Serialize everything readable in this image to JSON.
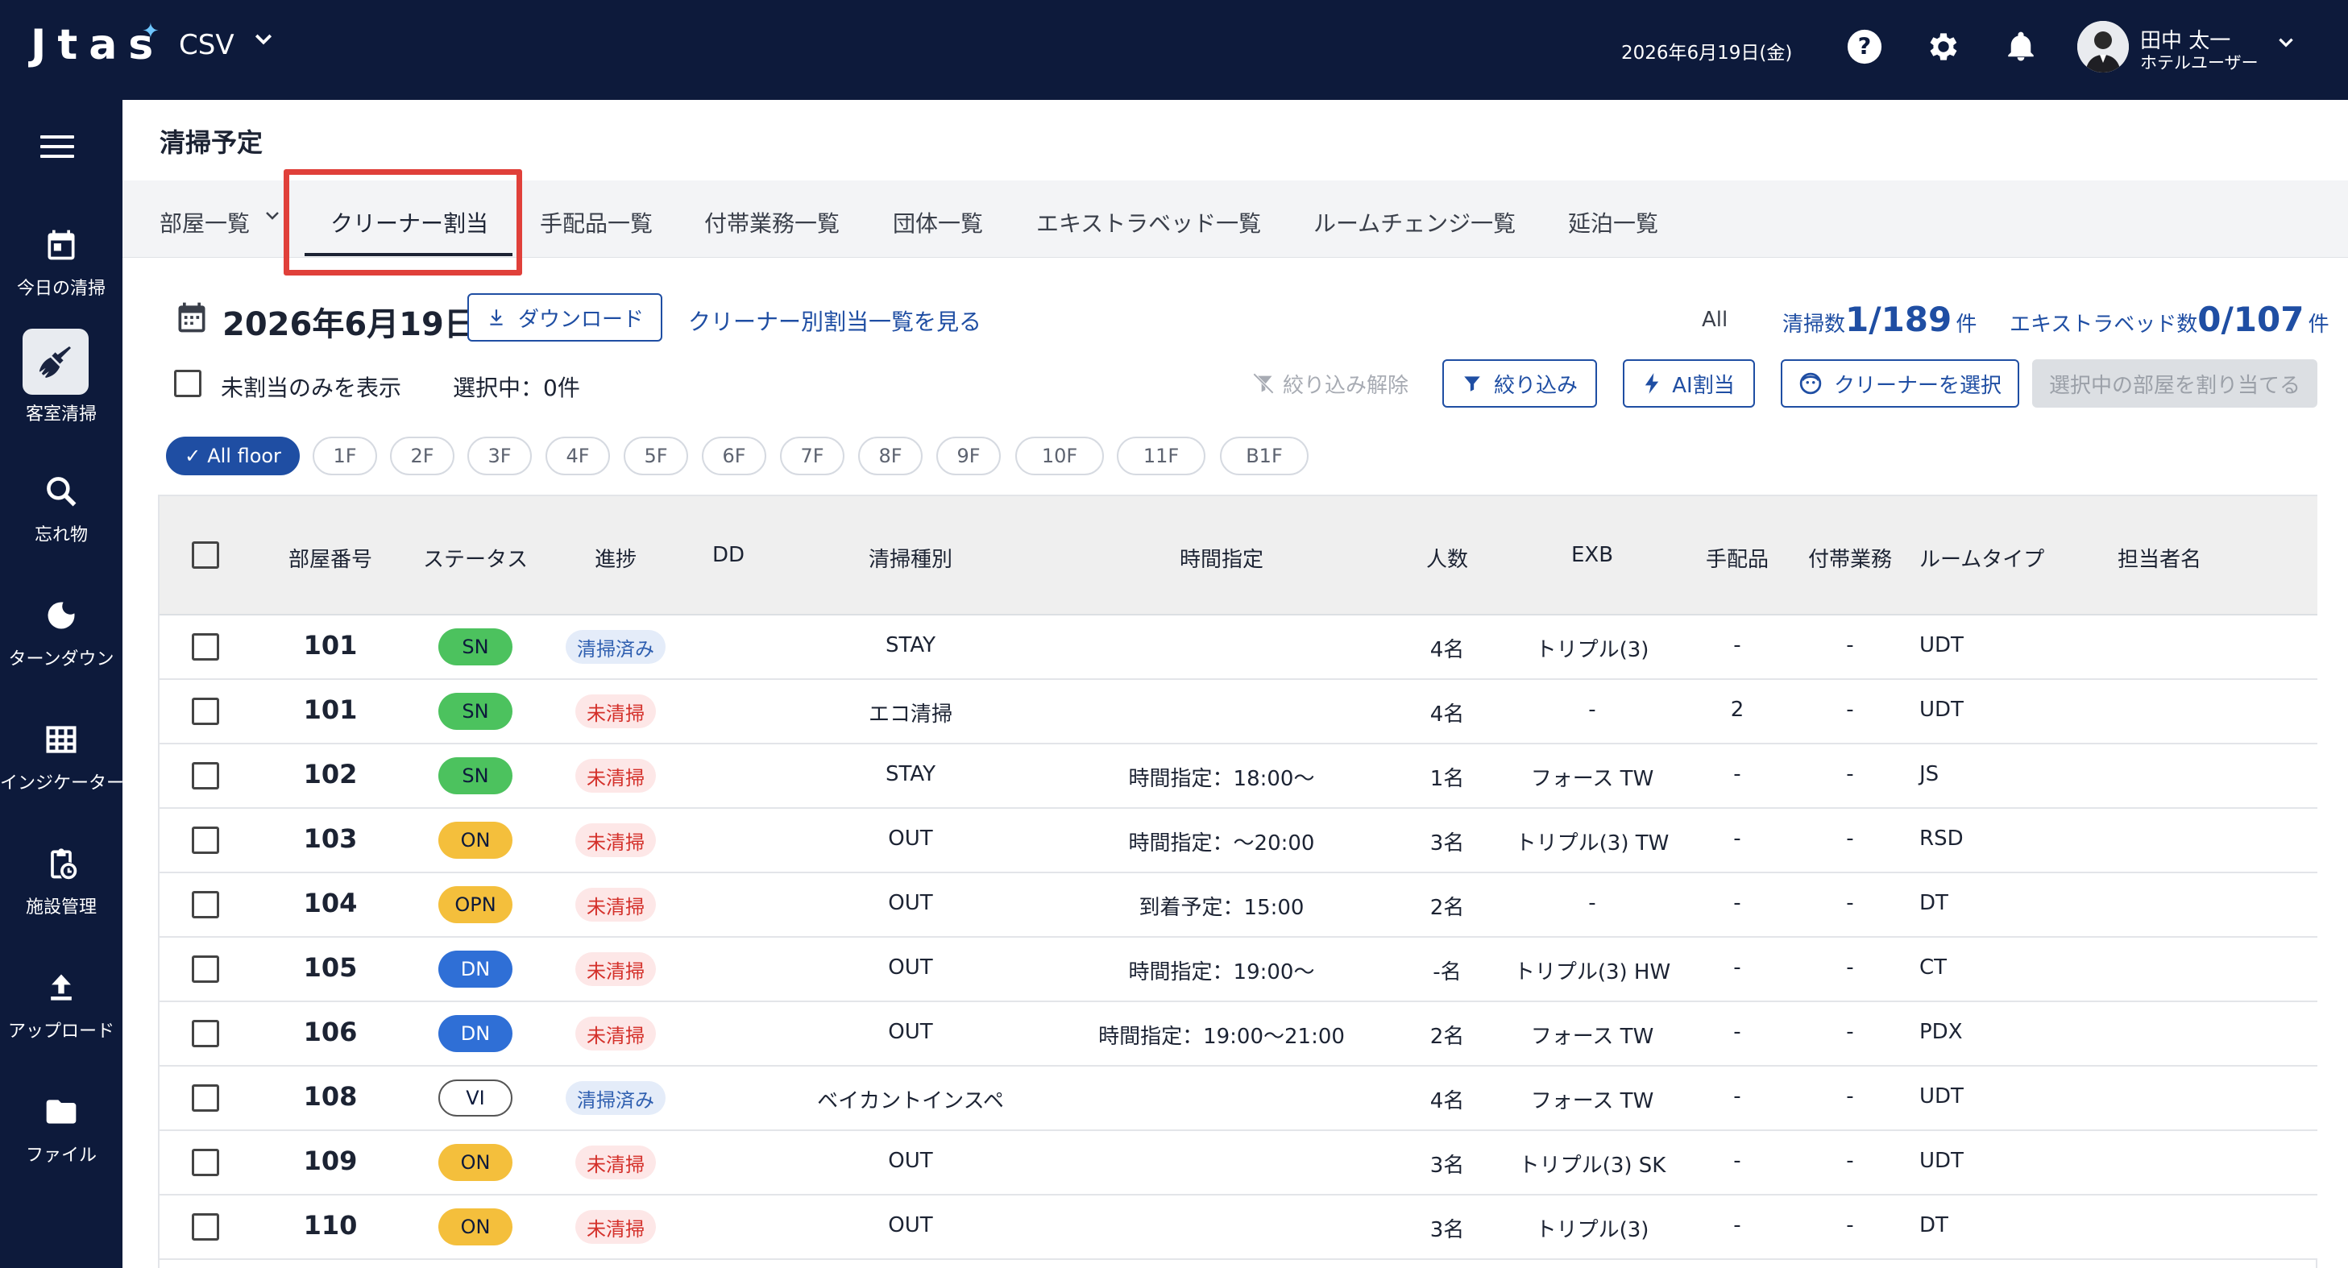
{
  "header": {
    "logo": "Jtas",
    "app_selector": "CSV",
    "date": "2026年6月19日(金)",
    "user_name": "田中 太一",
    "user_role": "ホテルユーザー"
  },
  "sidebar": {
    "items": [
      {
        "label": "今日の清掃",
        "icon": "calendar-icon"
      },
      {
        "label": "客室清掃",
        "icon": "broom-icon",
        "active": true
      },
      {
        "label": "忘れ物",
        "icon": "search-icon"
      },
      {
        "label": "ターンダウン",
        "icon": "moon-icon"
      },
      {
        "label": "インジケーター",
        "icon": "grid-icon"
      },
      {
        "label": "施設管理",
        "icon": "clipboard-icon"
      },
      {
        "label": "アップロード",
        "icon": "upload-icon"
      },
      {
        "label": "ファイル",
        "icon": "folder-icon"
      }
    ]
  },
  "page": {
    "title": "清掃予定"
  },
  "tabs": [
    {
      "label": "部屋一覧"
    },
    {
      "label": "クリーナー割当",
      "active": true
    },
    {
      "label": "手配品一覧"
    },
    {
      "label": "付帯業務一覧"
    },
    {
      "label": "団体一覧"
    },
    {
      "label": "エキストラベッド一覧"
    },
    {
      "label": "ルームチェンジ一覧"
    },
    {
      "label": "延泊一覧"
    }
  ],
  "toolbar": {
    "date": "2026年6月19日",
    "download": "ダウンロード",
    "cleaner_list_link": "クリーナー別割当一覧を見る",
    "stat_all": "All",
    "clean_label": "清掃数",
    "clean_value": "1/189",
    "unit": "件",
    "extrabed_label": "エキストラベッド数",
    "extrabed_value": "0/107",
    "unassigned_only": "未割当のみを表示",
    "selected": "選択中：0件",
    "clear_filter": "絞り込み解除",
    "filter": "絞り込み",
    "ai_assign": "AI割当",
    "select_cleaner": "クリーナーを選択",
    "assign_selected": "選択中の部屋を割り当てる"
  },
  "floors": [
    "All floor",
    "1F",
    "2F",
    "3F",
    "4F",
    "5F",
    "6F",
    "7F",
    "8F",
    "9F",
    "10F",
    "11F",
    "B1F"
  ],
  "table": {
    "headers": [
      "部屋番号",
      "ステータス",
      "進捗",
      "DD",
      "清掃種別",
      "時間指定",
      "人数",
      "EXB",
      "手配品",
      "付帯業務",
      "ルームタイプ",
      "担当者名"
    ],
    "rows": [
      {
        "room": "101",
        "status": "SN",
        "progress": "清掃済み",
        "dd": "",
        "type": "STAY",
        "time": "",
        "people": "4名",
        "exb": "トリプル(3)",
        "items": "-",
        "tasks": "-",
        "roomtype": "UDT",
        "staff": ""
      },
      {
        "room": "101",
        "status": "SN",
        "progress": "未清掃",
        "dd": "",
        "type": "エコ清掃",
        "time": "",
        "people": "4名",
        "exb": "-",
        "items": "2",
        "tasks": "-",
        "roomtype": "UDT",
        "staff": ""
      },
      {
        "room": "102",
        "status": "SN",
        "progress": "未清掃",
        "dd": "",
        "type": "STAY",
        "time": "時間指定：18:00〜",
        "people": "1名",
        "exb": "フォース TW",
        "items": "-",
        "tasks": "-",
        "roomtype": "JS",
        "staff": ""
      },
      {
        "room": "103",
        "status": "ON",
        "progress": "未清掃",
        "dd": "",
        "type": "OUT",
        "time": "時間指定：〜20:00",
        "people": "3名",
        "exb": "トリプル(3) TW",
        "items": "-",
        "tasks": "-",
        "roomtype": "RSD",
        "staff": ""
      },
      {
        "room": "104",
        "status": "OPN",
        "progress": "未清掃",
        "dd": "",
        "type": "OUT",
        "time": "到着予定：15:00",
        "people": "2名",
        "exb": "-",
        "items": "-",
        "tasks": "-",
        "roomtype": "DT",
        "staff": ""
      },
      {
        "room": "105",
        "status": "DN",
        "progress": "未清掃",
        "dd": "",
        "type": "OUT",
        "time": "時間指定：19:00〜",
        "people": "-名",
        "exb": "トリプル(3) HW",
        "items": "-",
        "tasks": "-",
        "roomtype": "CT",
        "staff": ""
      },
      {
        "room": "106",
        "status": "DN",
        "progress": "未清掃",
        "dd": "",
        "type": "OUT",
        "time": "時間指定：19:00〜21:00",
        "people": "2名",
        "exb": "フォース TW",
        "items": "-",
        "tasks": "-",
        "roomtype": "PDX",
        "staff": ""
      },
      {
        "room": "108",
        "status": "VI",
        "progress": "清掃済み",
        "dd": "",
        "type": "ベイカントインスペ",
        "time": "",
        "people": "4名",
        "exb": "フォース TW",
        "items": "-",
        "tasks": "-",
        "roomtype": "UDT",
        "staff": ""
      },
      {
        "room": "109",
        "status": "ON",
        "progress": "未清掃",
        "dd": "",
        "type": "OUT",
        "time": "",
        "people": "3名",
        "exb": "トリプル(3) SK",
        "items": "-",
        "tasks": "-",
        "roomtype": "UDT",
        "staff": ""
      },
      {
        "room": "110",
        "status": "ON",
        "progress": "未清掃",
        "dd": "",
        "type": "OUT",
        "time": "",
        "people": "3名",
        "exb": "トリプル(3)",
        "items": "-",
        "tasks": "-",
        "roomtype": "DT",
        "staff": ""
      }
    ]
  },
  "colors": {
    "navy": "#0d1a3b",
    "accent": "#1f4ea3",
    "highlight": "#e0403a",
    "status_SN": "#4cc25e",
    "status_ON": "#f4bf3c",
    "status_OPN": "#f4bf3c",
    "status_DN": "#2f6fd6",
    "status_VI": "#ffffff"
  }
}
